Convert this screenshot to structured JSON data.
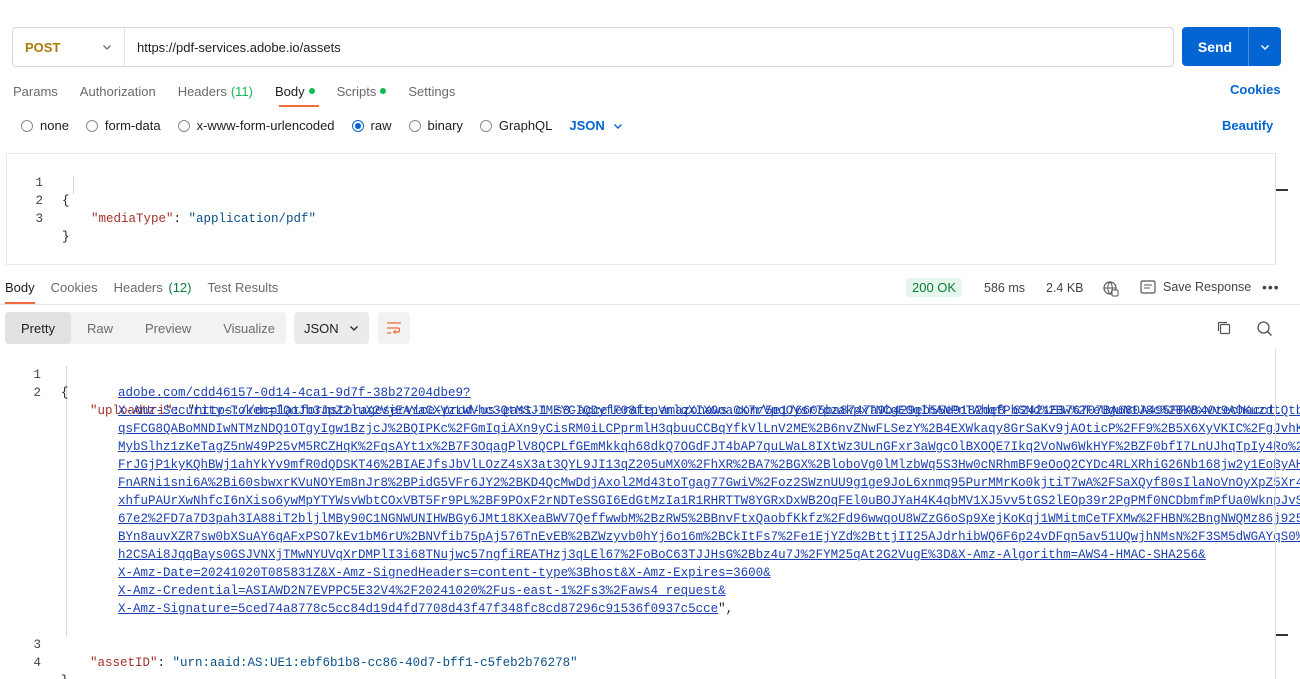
{
  "request": {
    "method": "POST",
    "url": "https://pdf-services.adobe.io/assets",
    "send_label": "Send"
  },
  "request_tabs": [
    {
      "label": "Params"
    },
    {
      "label": "Authorization"
    },
    {
      "label": "Headers",
      "count": "(11)"
    },
    {
      "label": "Body",
      "active": true
    },
    {
      "label": "Scripts"
    },
    {
      "label": "Settings"
    }
  ],
  "cookies_label": "Cookies",
  "body_types": [
    "none",
    "form-data",
    "x-www-form-urlencoded",
    "raw",
    "binary",
    "GraphQL"
  ],
  "body_format": "JSON",
  "beautify_label": "Beautify",
  "request_body": {
    "lines": [
      "1",
      "2",
      "3"
    ],
    "open_brace": "{",
    "key": "\"mediaType\"",
    "colon": ": ",
    "value": "\"application/pdf\"",
    "close_brace": "}"
  },
  "response_tabs": {
    "body": "Body",
    "cookies": "Cookies",
    "headers": "Headers",
    "headers_count": "(12)",
    "test_results": "Test Results"
  },
  "response_meta": {
    "status": "200 OK",
    "time": "586 ms",
    "size": "2.4 KB",
    "save_label": "Save Response",
    "more": "•••"
  },
  "view_modes": [
    "Pretty",
    "Raw",
    "Preview",
    "Visualize"
  ],
  "response_format": "JSON",
  "response_body": {
    "line_numbers": [
      "1",
      "2",
      "3",
      "4"
    ],
    "open_brace": "{",
    "upload_key": "\"uploadUri\"",
    "upload_url_lines": [
      "https://dcplatformstorageservice-prod-us-east-1.s3-accelerate.amazonaws.com/5e176605ba8747a9b429eb55e9182de8_62421E376707BA680A495FFA%40techacct.",
      "adobe.com/cdd46157-0d14-4ca1-9d7f-38b27204dbe9?",
      "X-Amz-Security-Token=IQoJb3JpZ2luX2VjEAYaCXVzLWVhc3QtMSJIMEYCIQDyfF08ftpVnlqXIXOoa0K7rVpqOysr7pzakpxTNCgE0gIhANPnTAhqfPbSNd%2Bw%2FeUguN1J8c%2BKBxvv9A0KuzdtQtbQK",
      "qsFCG8QABoMNDIwNTMzNDQ1OTgyIgw1BzjcJ%2BQIPKc%2FGmIqiAXn9yCisRM0iLCPprmlH3qbuuCCBqYfkVlLnV2ME%2B6nvZNwFLSezY%2B4EXWkaqy8GrSaKv9jAOticP%2FF9%2B5X6XyVKIC%2FgJvhKDH",
      "MybSlhz1zKeTagZ5nW49P25vM5RCZHqK%2FqsAYt1x%2B7F3OqagPlV8QCPLfGEmMkkqh68dkQ7OGdFJT4bAP7quLWaL8IXtWz3ULnGFxr3aWgcOlBXOQE7Ikq2VoNw6WkHYF%2BZF0bfI7LnUJhqTpIy4Ro%2Bo",
      "FrJGjP1kyKQhBWj1ahYkYv9mfR0dQDSKT46%2BIAEJfsJbVlLOzZ4sX3at3QYL9JI13qZ205uMX0%2FhXR%2BA7%2BGX%2BloboVg0lMlzbWq5S3Hw0cNRhmBF9eOoQ2CYDc4RLXRhiG26Nb168jw2y1EoByAHrO",
      "FnARNi1sni6A%2Bi60sbwxrKVuNOYEm8nJr8%2BPidG5VFr6JY2%2BKD4QcMwDdjAxol2Md43toTgag77GwiV%2Foz2SWznUU9g1ge9JoL6xnmq95PurMMrKo0kjtiT7wA%2FSaXQyf80sIlaNoVnOyXpZ5Xr4YC",
      "xhfuPAUrXwNhfcI6nXiso6ywMpYTYWsvWbtCOxVBT5Fr9PL%2BF9POxF2rNDTeSSGI6EdGtMzIa1R1RHRTTW8YGRxDxWB2OqFEl0uBOJYaH4K4qbMV1XJ5vv5tGS2lEOp39r2PgPMf0NCDbmfmPfUa0WknpJvS7P",
      "67e2%2FD7a7D3pah3IA88iT2bljlMBy90C1NGNWUNIHWBGy6JMt18KXeaBWV7QeffwwbM%2BzRW5%2BBnvFtxQaobfKkfz%2Fd96wwqoU8WZzG6oSp9XejKoKqj1WMitmCeTFXMw%2FHBN%2BngNWQMz86j925%2",
      "BYn8auvXZR7sw0bXSuAY6qAFxPSO7kEv1bM6rU%2BNVfib75pAj576TnEvEB%2BZWzyvb0hYj6o16m%2BCkItFs7%2Fe1EjYZd%2BttjII25AJdrhibWQ6F6p24vDFqn5av51UQwjhNMsN%2F3SM5dWGAYqS0%2F",
      "h2CSAi8JqqBays0GSJVNXjTMwNYUVqXrDMPlI3i68TNujwc57ngfiREATHzj3qLEl67%2FoBoC63TJJHsG%2Bbz4u7J%2FYM25qAt2G2VugE%3D&X-Amz-Algorithm=AWS4-HMAC-SHA256&",
      "X-Amz-Date=20241020T085831Z&X-Amz-SignedHeaders=content-type%3Bhost&X-Amz-Expires=3600&",
      "X-Amz-Credential=ASIAWD2N7EVPPC5E32V4%2F20241020%2Fus-east-1%2Fs3%2Faws4_request&",
      "X-Amz-Signature=5ced74a8778c5cc84d19d4fd7708d43f47f348fc8cd87296c91536f0937c5cce"
    ],
    "asset_key": "\"assetID\"",
    "asset_value": "\"urn:aaid:AS:UE1:ebf6b1b8-cc86-40d7-bff1-c5feb2b76278\"",
    "close_brace": "}"
  },
  "colors": {
    "accent": "#0265d2",
    "tab_indicator": "#f26b3a",
    "status_green": "#0cbb52",
    "method_post": "#ad7a03"
  }
}
